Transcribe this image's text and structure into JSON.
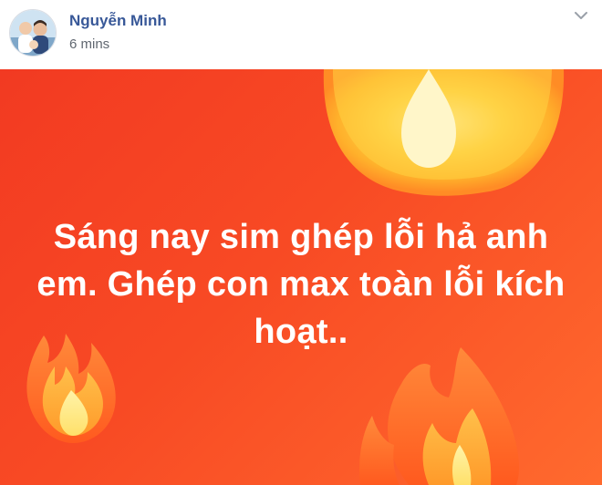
{
  "post": {
    "author_name": "Nguyễn Minh",
    "timestamp": "6 mins",
    "text": "Sáng nay sim ghép lỗi hả anh em. Ghép con max toàn lỗi kích hoạt.."
  },
  "icons": {
    "menu": "chevron-down-icon",
    "avatar": "profile-photo"
  },
  "colors": {
    "author_link": "#385898",
    "timestamp": "#606770",
    "background_start": "#f23a22",
    "background_end": "#ff6a2e",
    "text": "#ffffff"
  }
}
